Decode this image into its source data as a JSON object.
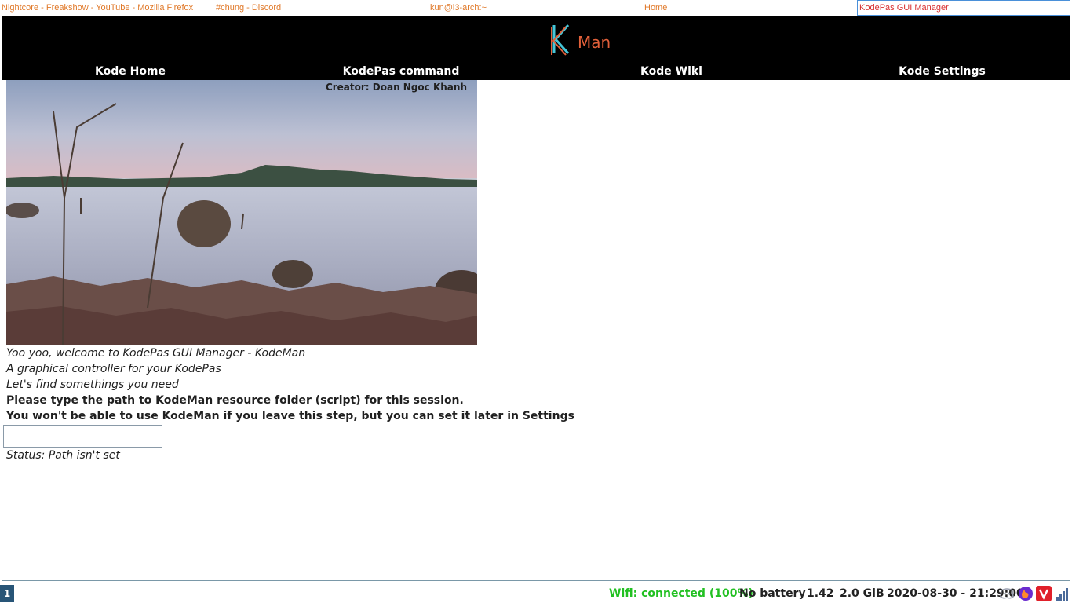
{
  "titlebar": {
    "tabs": [
      "Nightcore - Freakshow - YouTube - Mozilla Firefox",
      "#chung - Discord",
      "kun@i3-arch:~",
      "Home",
      "KodePas GUI Manager"
    ]
  },
  "app": {
    "logo_text": "Man",
    "nav": [
      "Kode Home",
      "KodePas command",
      "Kode Wiki",
      "Kode Settings"
    ],
    "creator": "Creator: Doan Ngoc Khanh",
    "lines": [
      "Yoo yoo, welcome to KodePas GUI Manager - KodeMan",
      "A graphical controller for your KodePas",
      "Let's find somethings you need",
      "Please type the path to KodeMan resource folder (script) for this session.",
      "You won't be able to use KodeMan if you leave this step, but you can set it later in Settings"
    ],
    "path_input": {
      "value": "",
      "placeholder": ""
    },
    "status": "Status: Path isn't set"
  },
  "statusbar": {
    "workspace": "1",
    "wifi": "Wifi: connected (100%)",
    "battery": "No battery",
    "load": "1.42",
    "memory": "2.0 GiB",
    "datetime": "2020-08-30 - 21:29:00",
    "wifi_color": "#22c022",
    "tray_icons": [
      "discord-icon",
      "firefox-icon",
      "vivaldi-icon",
      "signal-bars-icon"
    ]
  },
  "colors": {
    "accent": "#e2603a",
    "titlebar_text": "#e07828",
    "titlebar_active": "#d83030",
    "workspace_bg": "#285577"
  }
}
